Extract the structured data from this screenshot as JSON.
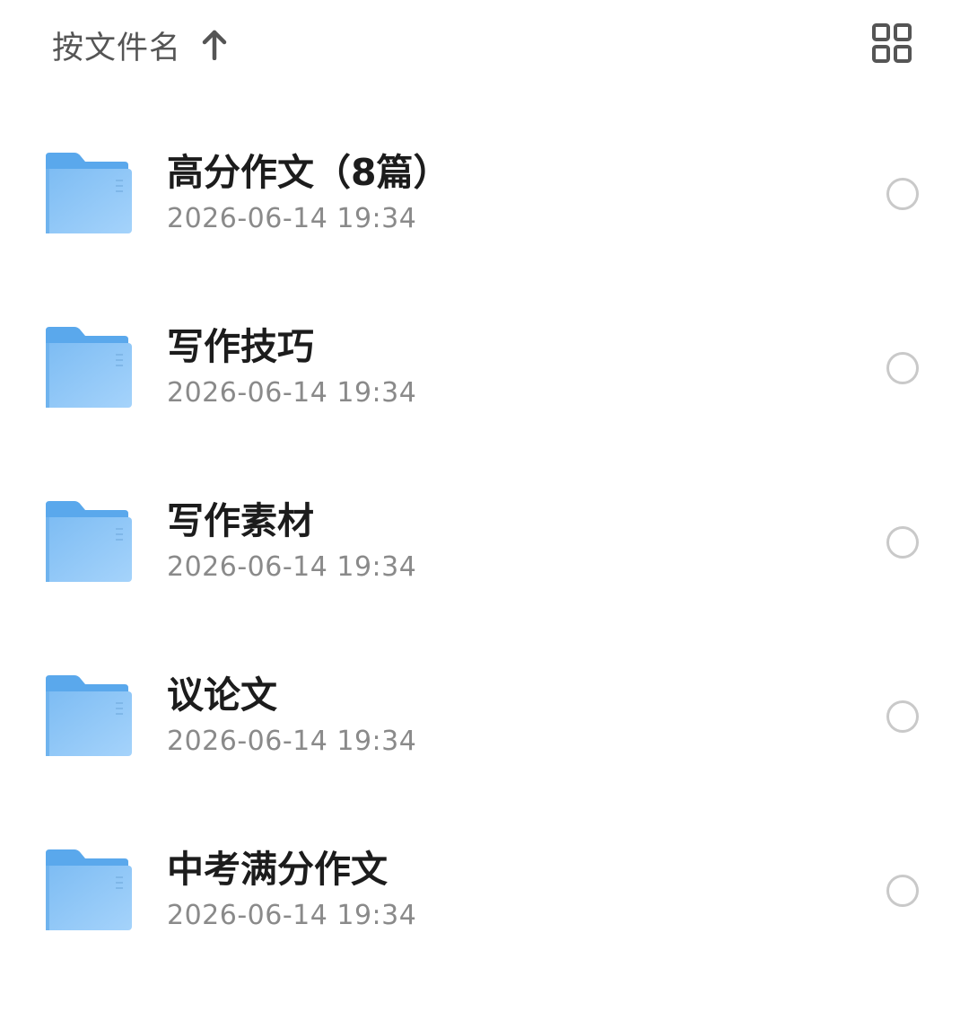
{
  "header": {
    "sort_label": "按文件名",
    "sort_direction_icon": "arrow-up-icon",
    "view_toggle_icon": "grid-view-icon"
  },
  "colors": {
    "folder_body": "#8cc4f5",
    "folder_tab": "#5aa8ec",
    "date_text": "#8a8a8a",
    "radio_border": "#c9c9c9"
  },
  "files": [
    {
      "name": "高分作文（8篇）",
      "date": "2026-06-14 19:34",
      "icon": "folder-icon"
    },
    {
      "name": "写作技巧",
      "date": "2026-06-14 19:34",
      "icon": "folder-icon"
    },
    {
      "name": "写作素材",
      "date": "2026-06-14 19:34",
      "icon": "folder-icon"
    },
    {
      "name": "议论文",
      "date": "2026-06-14 19:34",
      "icon": "folder-icon"
    },
    {
      "name": "中考满分作文",
      "date": "2026-06-14 19:34",
      "icon": "folder-icon"
    }
  ]
}
